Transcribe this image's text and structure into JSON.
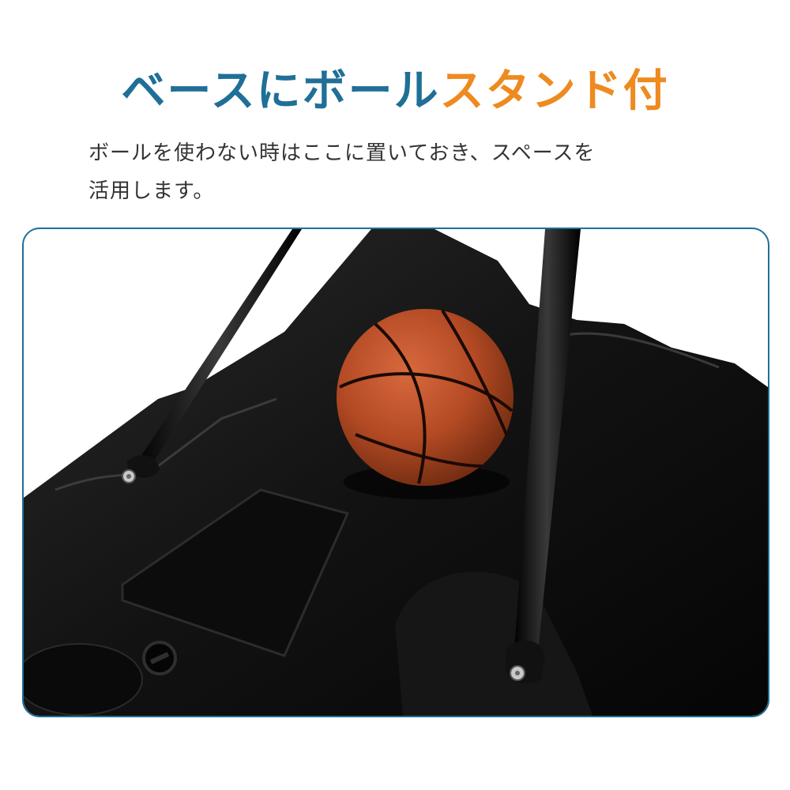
{
  "headline": {
    "part_blue": "ベースにボール",
    "part_orange": "スタンド付"
  },
  "description": {
    "line1": "ボールを使わない時はここに置いておき、スペースを",
    "line2": "活用します。"
  },
  "colors": {
    "blue": "#1f6f97",
    "orange": "#ee8a1f",
    "text": "#333333"
  }
}
